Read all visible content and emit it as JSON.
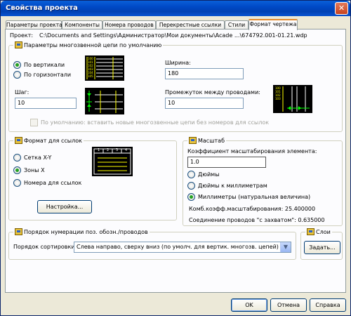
{
  "window": {
    "title": "Свойства проекта",
    "close_glyph": "✕"
  },
  "tabs": [
    "Параметры проекта",
    "Компоненты",
    "Номера проводов",
    "Перекрестные ссылки",
    "Стили",
    "Формат чертежа"
  ],
  "active_tab_index": 5,
  "project": {
    "label": "Проект:",
    "path": "C:\\Documents and Settings\\Администратор\\Мои документы\\Acade ...\\674792.001-01.21.wdp"
  },
  "multiwire": {
    "title": "Параметры многозвенной цепи по умолчанию",
    "vertical_label": "По вертикали",
    "horizontal_label": "По горизонтали",
    "selected": "vertical",
    "width_label": "Ширина:",
    "width_value": "180",
    "step_label": "Шаг:",
    "step_value": "10",
    "spacing_label": "Промежуток между проводами:",
    "spacing_value": "10",
    "thumb_numbers": [
      "100",
      "101",
      "102",
      "103",
      "104",
      "105"
    ],
    "default_checkbox_label": "По умолчанию: вставить новые многозвенные цепи без номеров для ссылок",
    "default_checkbox_checked": false
  },
  "ref_format": {
    "title": "Формат для ссылок",
    "options": [
      "Сетка X-Y",
      "Зоны X",
      "Номера для ссылок"
    ],
    "selected_index": 1,
    "setup_button": "Настройка...",
    "zone_numbers": [
      "1",
      "2",
      "3",
      "4"
    ]
  },
  "scale": {
    "title": "Масштаб",
    "factor_label": "Коэффициент масштабирования элемента:",
    "factor_value": "1.0",
    "options": [
      "Дюймы",
      "Дюймы к миллиметрам",
      "Миллиметры (натуральная величина)"
    ],
    "selected_index": 2,
    "combined_text": "Комб.коэфф.масштабирования: 25.400000",
    "connect_text": "Соединение проводов \"с захватом\": 0.635000"
  },
  "numbering": {
    "title": "Порядок нумерации поз. обозн./проводов",
    "sort_label": "Порядок сортировки:",
    "sort_value": "Слева направо, сверху вниз (по умолч. для вертик. многозв. цепей)"
  },
  "layers": {
    "title": "Слои",
    "set_button": "Задать..."
  },
  "footer": {
    "ok": "OK",
    "cancel": "Отмена",
    "help": "Справка"
  }
}
